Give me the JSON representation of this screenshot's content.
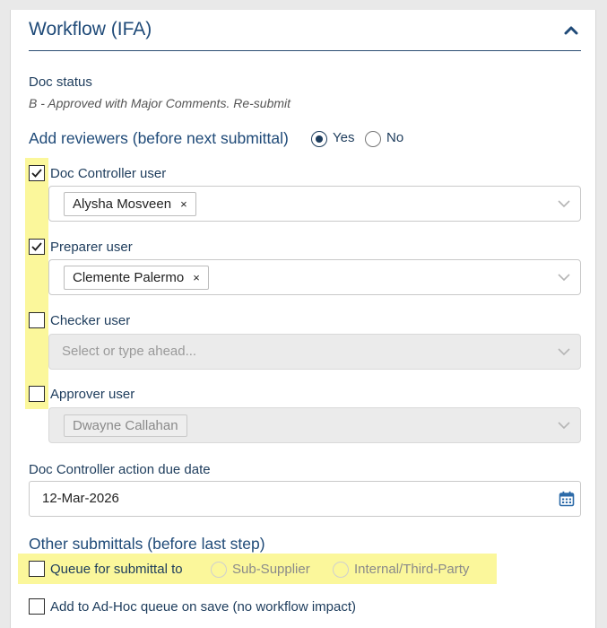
{
  "panel": {
    "title": "Workflow (IFA)",
    "collapse_icon": "chevron-up-icon"
  },
  "doc_status": {
    "label": "Doc status",
    "value": "B - Approved with Major Comments. Re-submit"
  },
  "add_reviewers": {
    "label": "Add reviewers (before next submittal)",
    "options": [
      {
        "label": "Yes",
        "selected": true
      },
      {
        "label": "No",
        "selected": false
      }
    ]
  },
  "reviewers": [
    {
      "label": "Doc Controller user",
      "checked": true,
      "disabled": false,
      "value": "Alysha Mosveen",
      "remove": "×",
      "placeholder": ""
    },
    {
      "label": "Preparer user",
      "checked": true,
      "disabled": false,
      "value": "Clemente Palermo",
      "remove": "×",
      "placeholder": ""
    },
    {
      "label": "Checker user",
      "checked": false,
      "disabled": true,
      "value": "",
      "remove": "",
      "placeholder": "Select or type ahead..."
    },
    {
      "label": "Approver user",
      "checked": false,
      "disabled": true,
      "value": "Dwayne Callahan",
      "remove": "",
      "placeholder": ""
    }
  ],
  "due_date": {
    "label": "Doc Controller action due date",
    "value": "12-Mar-2026",
    "icon": "calendar-icon"
  },
  "other_submittals": {
    "label": "Other submittals (before last step)",
    "queue_label": "Queue for submittal to",
    "queue_checked": false,
    "options": [
      {
        "label": "Sub-Supplier",
        "selected": false,
        "disabled": true
      },
      {
        "label": "Internal/Third-Party",
        "selected": false,
        "disabled": true
      }
    ],
    "adhoc_label": "Add to Ad-Hoc queue on save (no workflow impact)",
    "adhoc_checked": false
  },
  "colors": {
    "accent": "#1f4a78",
    "highlight": "#fbf79b"
  }
}
